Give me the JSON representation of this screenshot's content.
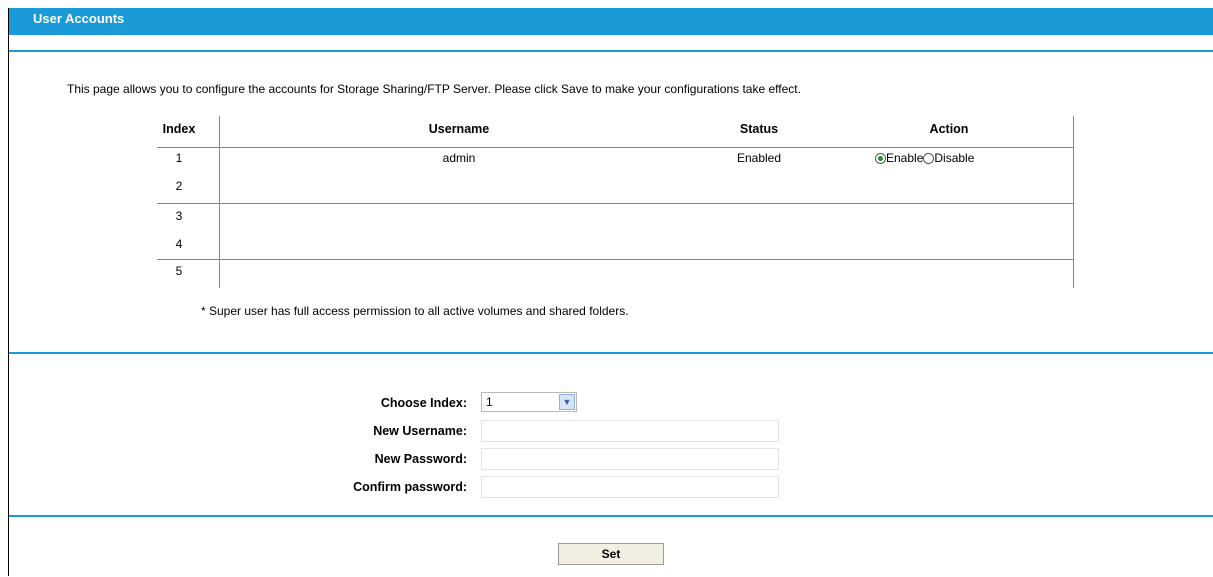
{
  "window": {
    "title": "User Accounts"
  },
  "intro": "This page allows you to configure the accounts for Storage Sharing/FTP Server. Please click Save to make your configurations take effect.",
  "table": {
    "headers": {
      "index": "Index",
      "username": "Username",
      "status": "Status",
      "action": "Action"
    },
    "rows": [
      {
        "index": "1",
        "username": "admin",
        "status": "Enabled",
        "enable_label": "Enable",
        "disable_label": "Disable",
        "selected": "Enable"
      },
      {
        "index": "2",
        "username": "",
        "status": ""
      },
      {
        "index": "3",
        "username": "",
        "status": ""
      },
      {
        "index": "4",
        "username": "",
        "status": ""
      },
      {
        "index": "5",
        "username": "",
        "status": ""
      }
    ]
  },
  "note": "*  Super user has full access permission to all active volumes and shared folders.",
  "form": {
    "choose_index_label": "Choose Index:",
    "choose_index_value": "1",
    "new_username_label": "New Username:",
    "new_password_label": "New Password:",
    "confirm_password_label": "Confirm password:"
  },
  "buttons": {
    "set": "Set"
  },
  "colors": {
    "accent": "#1a9bd7",
    "radio_selected": "#2a8a2a"
  }
}
